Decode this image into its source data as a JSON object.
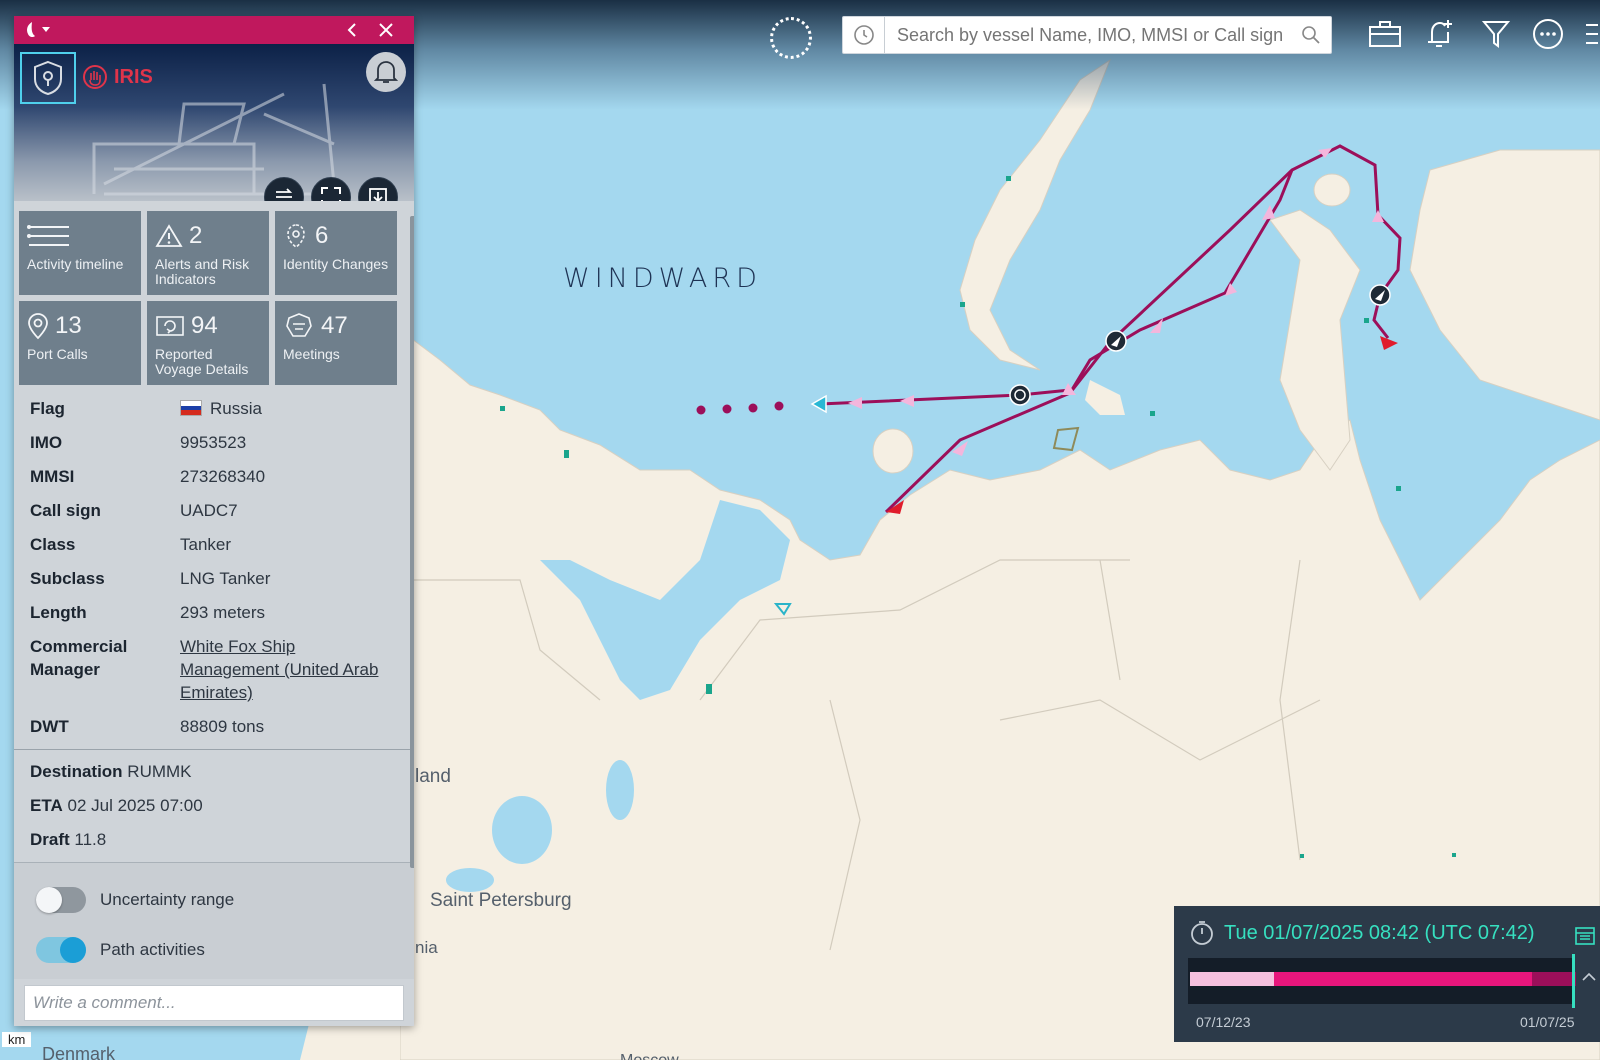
{
  "map": {
    "brand": "WINDWARD",
    "labels": {
      "city": "Saint Petersburg",
      "region": "land",
      "region2": "nia",
      "country": "Denmark",
      "country2": "Moscow",
      "scale": "km"
    }
  },
  "topbar": {
    "search_placeholder": "Search by vessel Name, IMO, MMSI or Call sign"
  },
  "panel": {
    "badge": "IRIS",
    "tiles": [
      {
        "count": "",
        "label": "Activity timeline",
        "icon": "list-icon"
      },
      {
        "count": "2",
        "label": "Alerts and Risk Indicators",
        "icon": "warning-icon"
      },
      {
        "count": "6",
        "label": "Identity Changes",
        "icon": "identity-icon"
      },
      {
        "count": "13",
        "label": "Port Calls",
        "icon": "pin-icon"
      },
      {
        "count": "94",
        "label": "Reported Voyage Details",
        "icon": "voyage-icon"
      },
      {
        "count": "47",
        "label": "Meetings",
        "icon": "meeting-icon"
      }
    ],
    "details": {
      "flag_label": "Flag",
      "flag_value": "Russia",
      "imo_label": "IMO",
      "imo_value": "9953523",
      "mmsi_label": "MMSI",
      "mmsi_value": "273268340",
      "callsign_label": "Call sign",
      "callsign_value": "UADC7",
      "class_label": "Class",
      "class_value": "Tanker",
      "subclass_label": "Subclass",
      "subclass_value": "LNG Tanker",
      "length_label": "Length",
      "length_value": "293 meters",
      "manager_label": "Commercial Manager",
      "manager_value": "White Fox Ship Management (United Arab Emirates)",
      "dwt_label": "DWT",
      "dwt_value": "88809 tons"
    },
    "voyage": {
      "destination_label": "Destination",
      "destination_value": "RUMMK",
      "eta_label": "ETA",
      "eta_value": "02 Jul 2025 07:00",
      "draft_label": "Draft",
      "draft_value": "11.8"
    },
    "toggles": {
      "uncertainty_label": "Uncertainty range",
      "uncertainty_on": false,
      "path_label": "Path activities",
      "path_on": true
    },
    "comment_placeholder": "Write a comment..."
  },
  "timeline": {
    "current": "Tue 01/07/2025 08:42 (UTC 07:42)",
    "start": "07/12/23",
    "end": "01/07/25"
  },
  "colors": {
    "accent": "#c0185d",
    "track": "#9c0f5a",
    "teal": "#36e0c0"
  }
}
